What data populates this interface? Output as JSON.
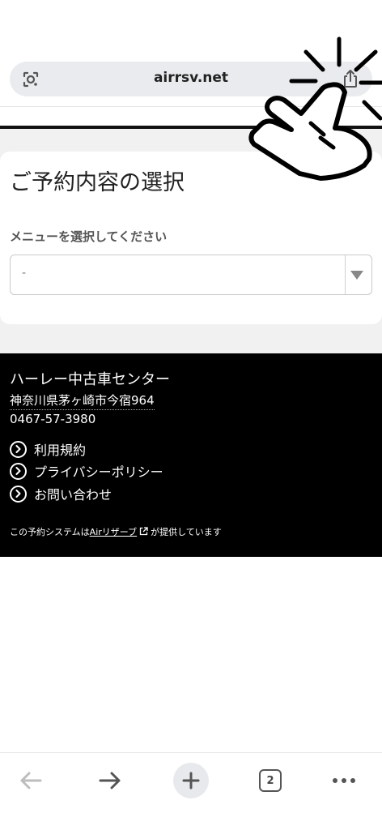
{
  "browser": {
    "url": "airrsv.net",
    "tab_count": "2",
    "icons": {
      "lens": "google-lens-icon",
      "share": "share-icon",
      "back": "back-arrow-icon",
      "forward": "forward-arrow-icon",
      "new_tab": "plus-icon",
      "tabs": "tab-switcher-icon",
      "more": "more-dots-icon"
    }
  },
  "main": {
    "title": "ご予約内容の選択",
    "menu_label": "メニューを選択してください",
    "menu_select_value": "-"
  },
  "footer": {
    "shop_name": "ハーレー中古車センター",
    "address": "神奈川県茅ヶ崎市今宿964",
    "phone": "0467-57-3980",
    "links": [
      {
        "label": "利用規約"
      },
      {
        "label": "プライバシーポリシー"
      },
      {
        "label": "お問い合わせ"
      }
    ],
    "powered_prefix": "この予約システムは",
    "powered_link": "Airリザーブ",
    "powered_suffix": "が提供しています"
  },
  "colors": {
    "footer_bg": "#000000",
    "page_bg": "#f1f1f2",
    "address_bar_bg": "#e9ebee"
  }
}
